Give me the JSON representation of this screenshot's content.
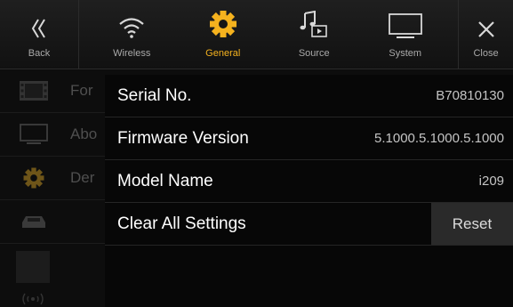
{
  "topbar": {
    "back_label": "Back",
    "close_label": "Close",
    "tabs": [
      {
        "label": "Wireless",
        "icon": "wifi-icon",
        "active": false
      },
      {
        "label": "General",
        "icon": "gear-icon",
        "active": true
      },
      {
        "label": "Source",
        "icon": "music-note-icon",
        "active": false
      },
      {
        "label": "System",
        "icon": "monitor-icon",
        "active": false
      }
    ],
    "accent_color": "#f5b21e"
  },
  "background_list": {
    "items": [
      {
        "label": "For",
        "icon": "film-icon"
      },
      {
        "label": "Abo",
        "icon": "monitor-icon"
      },
      {
        "label": "Der",
        "icon": "gear-icon"
      },
      {
        "label": "",
        "icon": "car-icon"
      }
    ]
  },
  "info_panel": {
    "rows": [
      {
        "label": "Serial No.",
        "value": "B70810130"
      },
      {
        "label": "Firmware Version",
        "value": "5.1000.5.1000.5.1000"
      },
      {
        "label": "Model Name",
        "value": "i209"
      },
      {
        "label": "Clear All Settings",
        "button": "Reset"
      }
    ]
  }
}
